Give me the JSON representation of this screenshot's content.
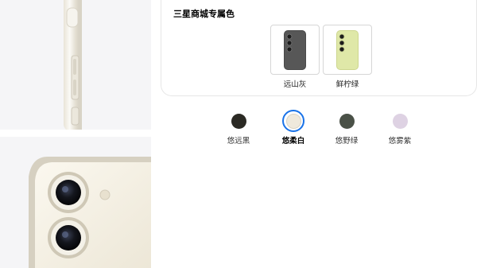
{
  "exclusive": {
    "title": "三星商城专属色",
    "items": [
      {
        "label": "远山灰",
        "color": "#4a4a4a"
      },
      {
        "label": "鲜柠绿",
        "color": "#dfe8a8"
      }
    ]
  },
  "colors": {
    "selected_index": 1,
    "options": [
      {
        "label": "悠远黑",
        "color": "#2b2a24"
      },
      {
        "label": "悠柔白",
        "color": "#efe9dc"
      },
      {
        "label": "悠野绿",
        "color": "#4a5147"
      },
      {
        "label": "悠雾紫",
        "color": "#ded2e3"
      }
    ]
  }
}
